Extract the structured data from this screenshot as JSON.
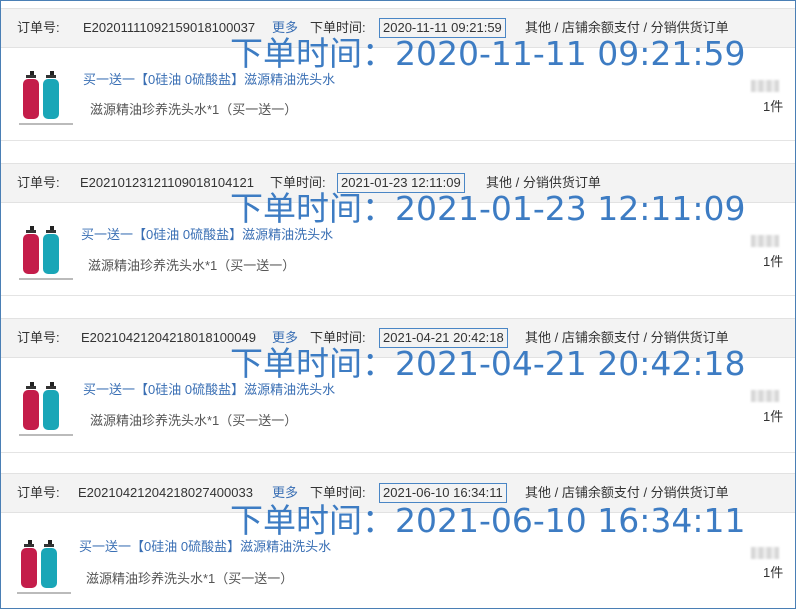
{
  "labels": {
    "order_no": "订单号:",
    "order_time": "下单时间:",
    "more": "更多",
    "big_prefix": "下单时间:"
  },
  "orders": [
    {
      "order_no": "E20201111092159018100037",
      "show_more": true,
      "time": "2020-11-11 09:21:59",
      "big_time": "下单时间：2020-11-11 09:21:59",
      "source": "其他 / 店铺余额支付 / 分销供货订单",
      "product_title": "买一送一【0硅油 0硫酸盐】滋源精油洗头水",
      "product_spec": "滋源精油珍养洗头水*1（买一送一）",
      "qty": "1件"
    },
    {
      "order_no": "E20210123121109018104121",
      "show_more": false,
      "time": "2021-01-23 12:11:09",
      "big_time": "下单时间：2021-01-23 12:11:09",
      "source": "其他 / 分销供货订单",
      "product_title": "买一送一【0硅油 0硫酸盐】滋源精油洗头水",
      "product_spec": "滋源精油珍养洗头水*1（买一送一）",
      "qty": "1件"
    },
    {
      "order_no": "E20210421204218018100049",
      "show_more": true,
      "time": "2021-04-21 20:42:18",
      "big_time": "下单时间：2021-04-21 20:42:18",
      "source": "其他 / 店铺余额支付 / 分销供货订单",
      "product_title": "买一送一【0硅油 0硫酸盐】滋源精油洗头水",
      "product_spec": "滋源精油珍养洗头水*1（买一送一）",
      "qty": "1件"
    },
    {
      "order_no": "E20210421204218027400033",
      "show_more": true,
      "time": "2021-06-10 16:34:11",
      "big_time": "下单时间：2021-06-10 16:34:11",
      "source": "其他 / 店铺余额支付 / 分销供货订单",
      "product_title": "买一送一【0硅油 0硫酸盐】滋源精油洗头水",
      "product_spec": "滋源精油珍养洗头水*1（买一送一）",
      "qty": "1件"
    }
  ],
  "colors": {
    "link": "#3a6fb4",
    "overlay": "#3d7cc3",
    "box": "#4a86c5",
    "header_bg": "#f3f3f3"
  }
}
